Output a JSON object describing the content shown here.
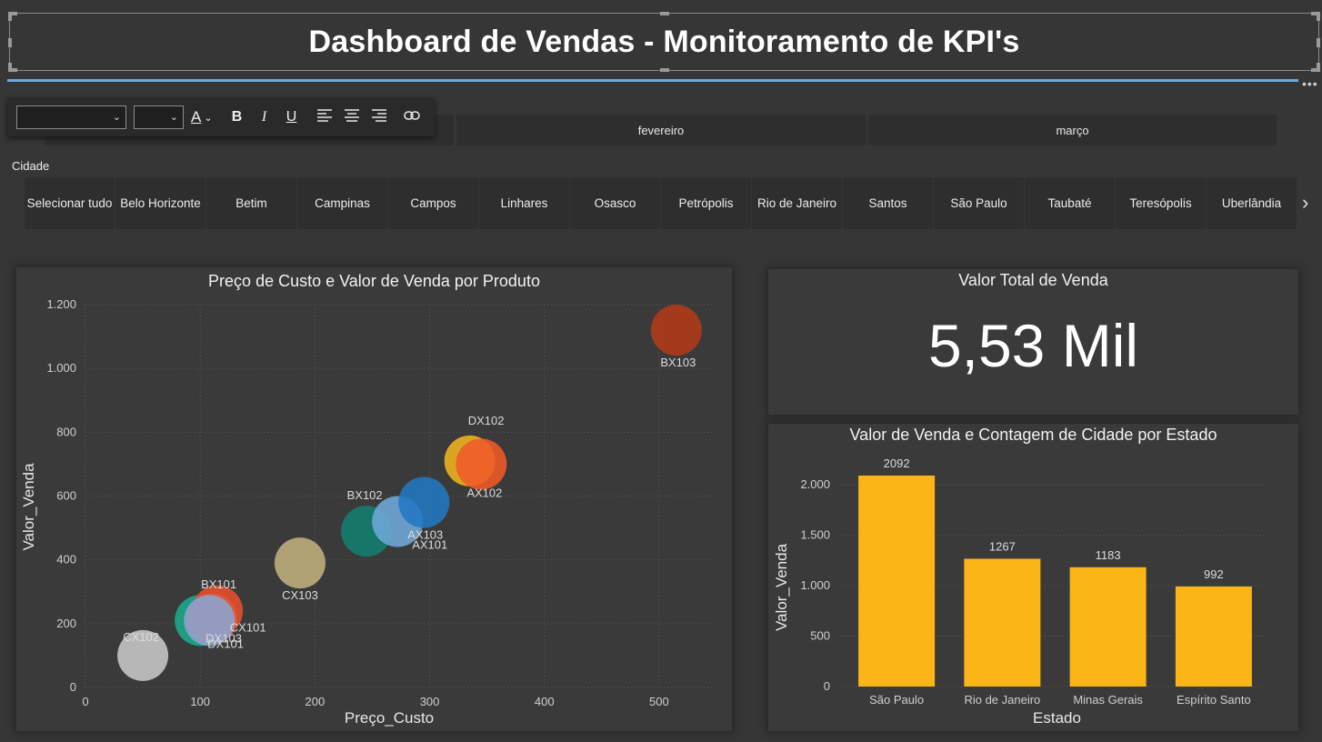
{
  "header": {
    "title": "Dashboard de Vendas - Monitoramento de KPI's",
    "more": "•••"
  },
  "toolbar": {
    "font_color_label": "A",
    "bold": "B",
    "italic": "I",
    "underline": "U"
  },
  "month_slicer": {
    "items": [
      "",
      "fevereiro",
      "março"
    ]
  },
  "city_slicer": {
    "label": "Cidade",
    "items": [
      "Selecionar tudo",
      "Belo Horizonte",
      "Betim",
      "Campinas",
      "Campos",
      "Linhares",
      "Osasco",
      "Petrópolis",
      "Rio de Janeiro",
      "Santos",
      "São Paulo",
      "Taubaté",
      "Teresópolis",
      "Uberlândia"
    ],
    "next": "›"
  },
  "kpi": {
    "title": "Valor Total de Venda",
    "value": "5,53 Mil"
  },
  "scatter": {
    "title": "Preço de Custo e Valor de Venda por Produto",
    "chart_data": {
      "type": "scatter",
      "title": "Preço de Custo e Valor de Venda por Produto",
      "xlabel": "Preço_Custo",
      "ylabel": "Valor_Venda",
      "xlim": [
        0,
        550
      ],
      "ylim": [
        0,
        1200
      ],
      "x_ticks": [
        "0",
        "100",
        "200",
        "300",
        "400",
        "500"
      ],
      "y_ticks": [
        "0",
        "200",
        "400",
        "600",
        "800",
        "1.000",
        "1.200"
      ],
      "grid": true,
      "points": [
        {
          "label": "CX102",
          "x": 50,
          "y": 100,
          "color": "#c8c8c8"
        },
        {
          "label": "DX103",
          "x": 100,
          "y": 210,
          "color": "#1aab8b"
        },
        {
          "label": "BX101",
          "x": 115,
          "y": 240,
          "color": "#e8502b"
        },
        {
          "label": "CX101",
          "x": 110,
          "y": 215,
          "color": "#e05a3a"
        },
        {
          "label": "DX101",
          "x": 108,
          "y": 210,
          "color": "#8aa4d0"
        },
        {
          "label": "CX103",
          "x": 187,
          "y": 390,
          "color": "#c2b07e"
        },
        {
          "label": "BX102",
          "x": 245,
          "y": 490,
          "color": "#118070"
        },
        {
          "label": "AX101",
          "x": 272,
          "y": 520,
          "color": "#6ea8d8"
        },
        {
          "label": "AX103",
          "x": 295,
          "y": 580,
          "color": "#2277c2"
        },
        {
          "label": "DX102",
          "x": 335,
          "y": 710,
          "color": "#f0b420"
        },
        {
          "label": "AX102",
          "x": 345,
          "y": 700,
          "color": "#f05a28"
        },
        {
          "label": "BX103",
          "x": 515,
          "y": 1120,
          "color": "#b23a18"
        }
      ]
    }
  },
  "bar": {
    "title": "Valor de Venda e Contagem de Cidade por Estado",
    "chart_data": {
      "type": "bar",
      "title": "Valor de Venda e Contagem de Cidade por Estado",
      "xlabel": "Estado",
      "ylabel": "Valor_Venda",
      "categories": [
        "São Paulo",
        "Rio de Janeiro",
        "Minas Gerais",
        "Espírito Santo"
      ],
      "values": [
        2092,
        1267,
        1183,
        992
      ],
      "data_labels": [
        "2092",
        "1267",
        "1183",
        "992"
      ],
      "ylim": [
        0,
        2200
      ],
      "y_ticks": [
        "0",
        "500",
        "1.000",
        "1.500",
        "2.000"
      ],
      "bar_color": "#fbb516",
      "grid": true
    }
  }
}
